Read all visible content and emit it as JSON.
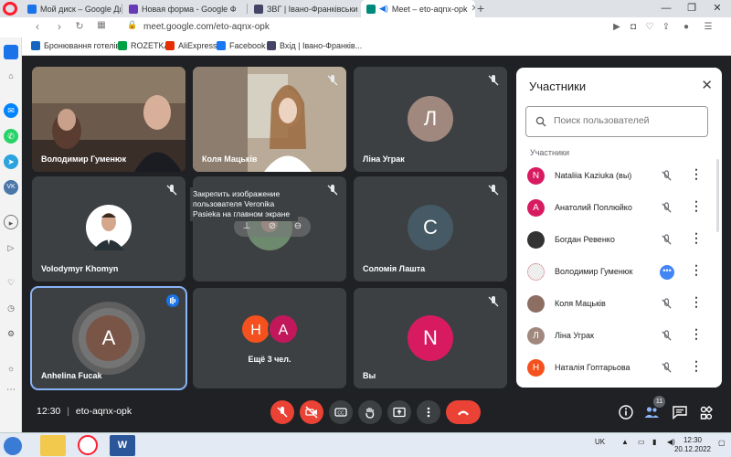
{
  "browser": {
    "tabs": [
      {
        "title": "Мой диск – Google Диск",
        "fav": "#1a73e8",
        "active": false
      },
      {
        "title": "Новая форма - Google Ф",
        "fav": "#673ab7",
        "active": false
      },
      {
        "title": "ЗВГ | Івано-Франківський",
        "fav": "#446",
        "active": false
      },
      {
        "title": "Meet – eto-aqnx-opk",
        "fav": "#00897b",
        "active": true
      }
    ],
    "url": "meet.google.com/eto-aqnx-opk",
    "bookmarks": [
      {
        "label": "Бронювання готелів",
        "fav": "#1565c0"
      },
      {
        "label": "ROZETKA",
        "fav": "#00a046"
      },
      {
        "label": "AliExpress",
        "fav": "#e62e04"
      },
      {
        "label": "Facebook",
        "fav": "#1877f2"
      },
      {
        "label": "Вхід | Івано-Франків...",
        "fav": "#446"
      }
    ]
  },
  "tiles": [
    {
      "name": "Володимир Гуменюк",
      "kind": "video",
      "muted": false
    },
    {
      "name": "Коля Мацьків",
      "kind": "video",
      "muted": true
    },
    {
      "name": "Ліна Уграк",
      "kind": "avatar",
      "initial": "Л",
      "color": "#a1887f",
      "muted": true
    },
    {
      "name": "Volodymyr Khomyn",
      "kind": "photo",
      "muted": true
    },
    {
      "name": "Veronika Pasieka",
      "kind": "pinhover",
      "muted": true
    },
    {
      "name": "Соломія Лашта",
      "kind": "avatar",
      "initial": "С",
      "color": "#455a64",
      "muted": true
    },
    {
      "name": "Anhelina Fucak",
      "kind": "avatar",
      "initial": "A",
      "color": "#795548",
      "speaking": true
    },
    {
      "name": "Ещё 3 чел.",
      "kind": "group",
      "initials": [
        "H",
        "A"
      ],
      "colors": [
        "#f4511e",
        "#c2185b"
      ]
    },
    {
      "name": "Вы",
      "kind": "avatar",
      "initial": "N",
      "color": "#d81b60",
      "muted": true
    }
  ],
  "tooltip": "Закрепить изображение пользователя Veronika Pasieka на главном экране",
  "panel": {
    "title": "Участники",
    "search_placeholder": "Поиск пользователей",
    "section": "Участники",
    "participants": [
      {
        "name": "Nataliia Kaziuka (вы)",
        "initial": "N",
        "color": "#d81b60",
        "state": "muted"
      },
      {
        "name": "Анатолий Поплюйко",
        "initial": "А",
        "color": "#d81b60",
        "state": "muted"
      },
      {
        "name": "Богдан Ревенко",
        "initial": "",
        "color": "#333333",
        "state": "muted"
      },
      {
        "name": "Володимир Гуменюк",
        "initial": "",
        "color": "#eeeeee",
        "state": "speaking"
      },
      {
        "name": "Коля Мацьків",
        "initial": "",
        "color": "#8d6e63",
        "state": "muted"
      },
      {
        "name": "Ліна Уграк",
        "initial": "Л",
        "color": "#a1887f",
        "state": "muted"
      },
      {
        "name": "Наталія Гоптарьова",
        "initial": "Н",
        "color": "#f4511e",
        "state": "muted"
      }
    ]
  },
  "meeting": {
    "time": "12:30",
    "code": "eto-aqnx-opk",
    "participant_count": "11"
  },
  "taskbar": {
    "lang": "UK",
    "time": "12:30",
    "date": "20.12.2022"
  }
}
